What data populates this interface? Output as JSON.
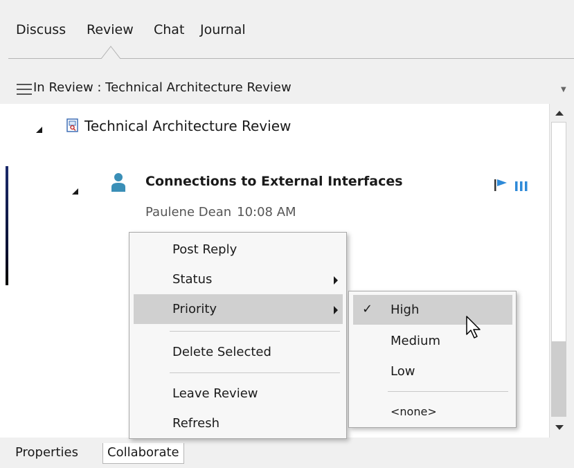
{
  "top_tabs": [
    "Discuss",
    "Review",
    "Chat",
    "Journal"
  ],
  "active_top_tab": "Review",
  "title_bar": {
    "text": "In Review : Technical Architecture Review"
  },
  "tree": {
    "review_node": "Technical Architecture Review",
    "discussion": {
      "title": "Connections to External Interfaces",
      "author": "Paulene Dean",
      "time": "10:08 AM"
    }
  },
  "context_menu": {
    "items": [
      "Post Reply",
      "Status",
      "Priority",
      "Delete Selected",
      "Leave Review",
      "Refresh"
    ],
    "highlighted": "Priority"
  },
  "priority_submenu": {
    "items": [
      "High",
      "Medium",
      "Low",
      "<none>"
    ],
    "checked": "High"
  },
  "bottom_tabs": [
    "Properties",
    "Collaborate"
  ],
  "active_bottom_tab": "Collaborate",
  "colors": {
    "flag_blue": "#2e8ad8",
    "person_teal": "#3a8fb7",
    "menu_highlight": "#d0d0d0"
  }
}
